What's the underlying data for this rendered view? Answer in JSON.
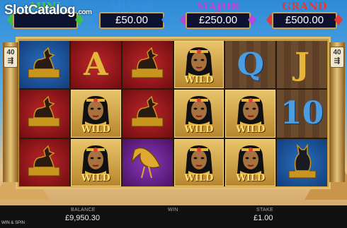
{
  "watermark": {
    "brand": "SlotCatalog",
    "suffix": ".com"
  },
  "jackpots": [
    {
      "name": "MINI",
      "amount": "",
      "title_color": "#48c04a",
      "gem_color": "#3cbf4a"
    },
    {
      "name": "MINOR",
      "amount": "£50.00",
      "title_color": "#3a8ce0",
      "gem_color": "#3a8ce0"
    },
    {
      "name": "MAJOR",
      "amount": "£250.00",
      "title_color": "#b04ad8",
      "gem_color": "#b04ad8"
    },
    {
      "name": "GRAND",
      "amount": "£500.00",
      "title_color": "#e03a3a",
      "gem_color": "#e03a3a"
    }
  ],
  "paylines": {
    "value": "40"
  },
  "reels": [
    [
      {
        "symbol": "anubis-statue",
        "bg": "blue"
      },
      {
        "symbol": "A",
        "bg": "red"
      },
      {
        "symbol": "anubis-statue",
        "bg": "red"
      },
      {
        "symbol": "cleopatra-wild",
        "bg": "wild"
      },
      {
        "symbol": "Q",
        "bg": "stone"
      },
      {
        "symbol": "J",
        "bg": "stone"
      }
    ],
    [
      {
        "symbol": "anubis-statue",
        "bg": "red"
      },
      {
        "symbol": "cleopatra-wild",
        "bg": "wild"
      },
      {
        "symbol": "anubis-statue",
        "bg": "red"
      },
      {
        "symbol": "cleopatra-wild",
        "bg": "wild"
      },
      {
        "symbol": "cleopatra-wild",
        "bg": "wild"
      },
      {
        "symbol": "10",
        "bg": "stone"
      }
    ],
    [
      {
        "symbol": "anubis-statue",
        "bg": "red"
      },
      {
        "symbol": "cleopatra-wild",
        "bg": "wild"
      },
      {
        "symbol": "ibis",
        "bg": "purple"
      },
      {
        "symbol": "cleopatra-wild",
        "bg": "wild"
      },
      {
        "symbol": "cleopatra-wild",
        "bg": "wild"
      },
      {
        "symbol": "bastet-cat",
        "bg": "blue"
      }
    ]
  ],
  "wild_text": "WILD",
  "bottom_bar": {
    "mode": "WIN & SPIN",
    "balance_label": "BALANCE",
    "balance_value": "£9,950.30",
    "win_label": "WIN",
    "win_value": "",
    "stake_label": "STAKE",
    "stake_value": "£1.00"
  }
}
